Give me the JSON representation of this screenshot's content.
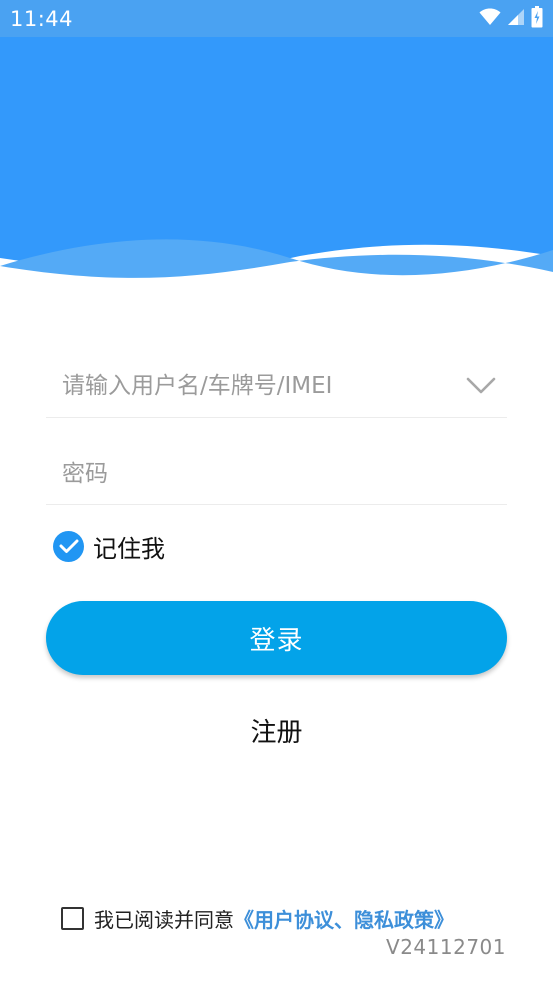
{
  "status_bar": {
    "time": "11:44",
    "icons": [
      "wifi-icon",
      "signal-icon",
      "battery-icon"
    ]
  },
  "colors": {
    "header_blue": "#3399fb",
    "status_bar_blue": "#4aa2f2",
    "wave_light_blue": "#54aaf6",
    "login_button": "#03a3e9",
    "checkbox_blue": "#2196f3",
    "link_blue": "#3d8fd9"
  },
  "login_form": {
    "username_placeholder": "请输入用户名/车牌号/IMEI",
    "username_value": "",
    "password_placeholder": "密码",
    "password_value": "",
    "remember_label": "记住我",
    "remember_checked": true,
    "login_label": "登录",
    "register_label": "注册"
  },
  "agreement": {
    "checked": false,
    "text": "我已阅读并同意",
    "link_text": "《用户协议、隐私政策》"
  },
  "version": "V24112701"
}
